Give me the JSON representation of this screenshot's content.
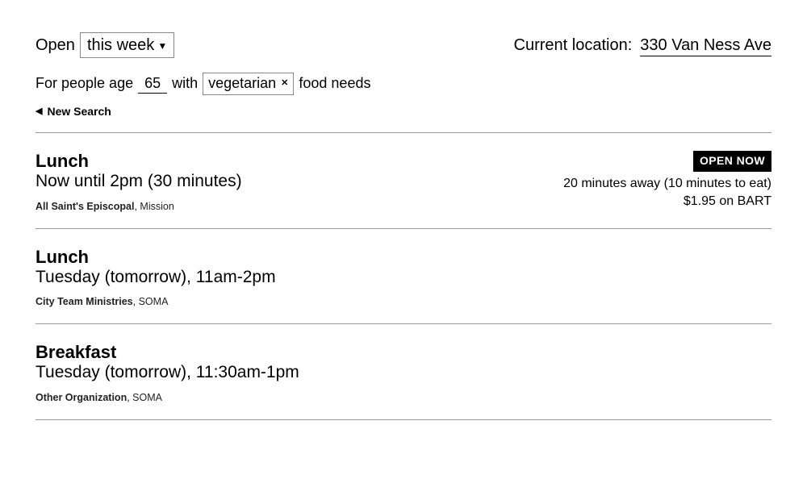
{
  "header": {
    "open_label": "Open",
    "timeframe": "this week",
    "current_location_label": "Current location:",
    "current_location_value": "330 Van Ness Ave"
  },
  "filter": {
    "prefix_age": "For people age",
    "age": "65",
    "with_label": "with",
    "diet_tag": "vegetarian",
    "suffix": "food needs"
  },
  "new_search_label": "New Search",
  "results": [
    {
      "meal": "Lunch",
      "schedule": "Now until 2pm (30 minutes)",
      "org_name": "All Saint's Episcopal",
      "org_area": "Mission",
      "badge": "OPEN NOW",
      "distance": "20 minutes away (10 minutes to eat)",
      "cost": "$1.95 on BART"
    },
    {
      "meal": "Lunch",
      "schedule": "Tuesday (tomorrow), 11am-2pm",
      "org_name": "City Team Ministries",
      "org_area": "SOMA"
    },
    {
      "meal": "Breakfast",
      "schedule": "Tuesday (tomorrow), 11:30am-1pm",
      "org_name": "Other Organization",
      "org_area": "SOMA"
    }
  ]
}
